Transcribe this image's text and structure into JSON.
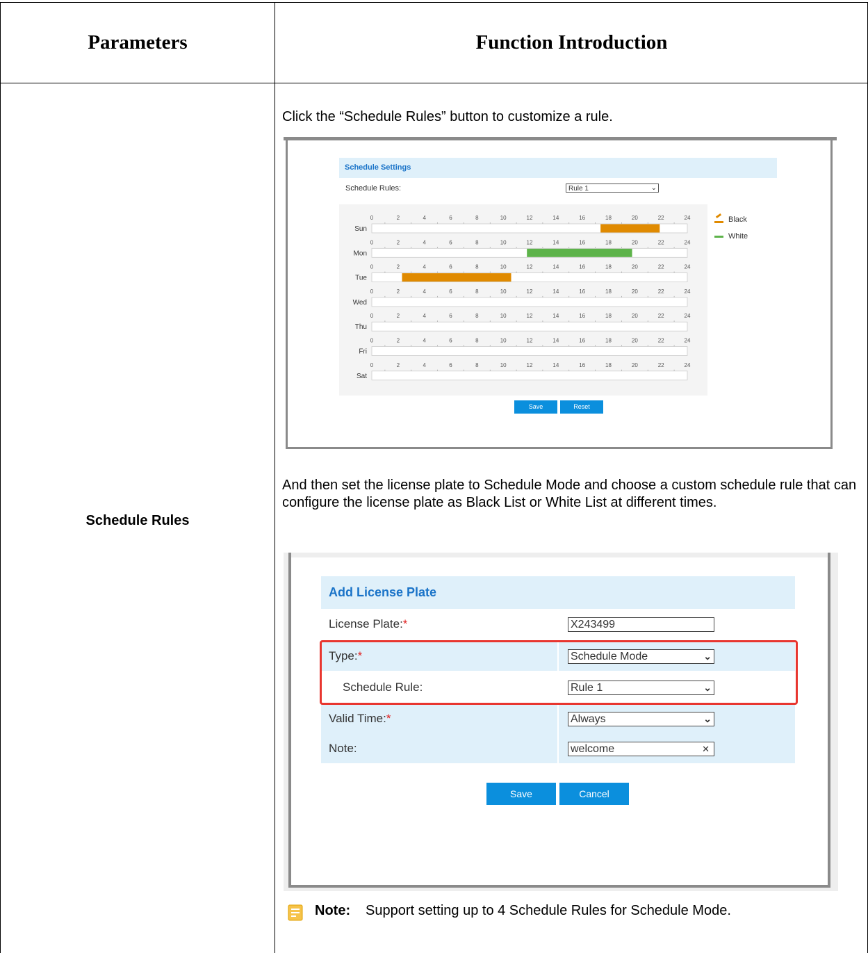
{
  "table": {
    "header_left": "Parameters",
    "header_right": "Function Introduction",
    "param_name": "Schedule Rules"
  },
  "paragraphs": {
    "intro": "Click the “Schedule Rules” button to customize a rule.",
    "then": "And then set the license plate to Schedule Mode and choose a custom schedule rule that can configure the license plate as Black List or White List at different times."
  },
  "schedule_settings": {
    "title": "Schedule Settings",
    "rules_label": "Schedule Rules:",
    "rules_value": "Rule 1",
    "ticks": [
      "0",
      "2",
      "4",
      "6",
      "8",
      "10",
      "12",
      "14",
      "16",
      "18",
      "20",
      "22",
      "24"
    ],
    "days": [
      {
        "label": "Sun",
        "segments": [
          {
            "start": 17.4,
            "end": 21.9,
            "type": "black"
          }
        ]
      },
      {
        "label": "Mon",
        "segments": [
          {
            "start": 11.8,
            "end": 19.8,
            "type": "white"
          }
        ]
      },
      {
        "label": "Tue",
        "segments": [
          {
            "start": 2.3,
            "end": 10.6,
            "type": "black"
          }
        ]
      },
      {
        "label": "Wed",
        "segments": []
      },
      {
        "label": "Thu",
        "segments": []
      },
      {
        "label": "Fri",
        "segments": []
      },
      {
        "label": "Sat",
        "segments": []
      }
    ],
    "legend": {
      "black": "Black",
      "white": "White"
    },
    "colors": {
      "black": "#e08a00",
      "white": "#5db34a"
    },
    "save_label": "Save",
    "reset_label": "Reset"
  },
  "add_plate": {
    "title": "Add License Plate",
    "fields": {
      "plate_label": "License Plate:",
      "plate_value": "X243499",
      "type_label": "Type:",
      "type_value": "Schedule Mode",
      "rule_label": "Schedule Rule:",
      "rule_value": "Rule 1",
      "valid_label": "Valid Time:",
      "valid_value": "Always",
      "note_label": "Note:",
      "note_value": "welcome"
    },
    "required_mark": "*",
    "save_label": "Save",
    "cancel_label": "Cancel"
  },
  "note": {
    "label": "Note:",
    "text": "Support setting up to 4 Schedule Rules for Schedule Mode."
  }
}
